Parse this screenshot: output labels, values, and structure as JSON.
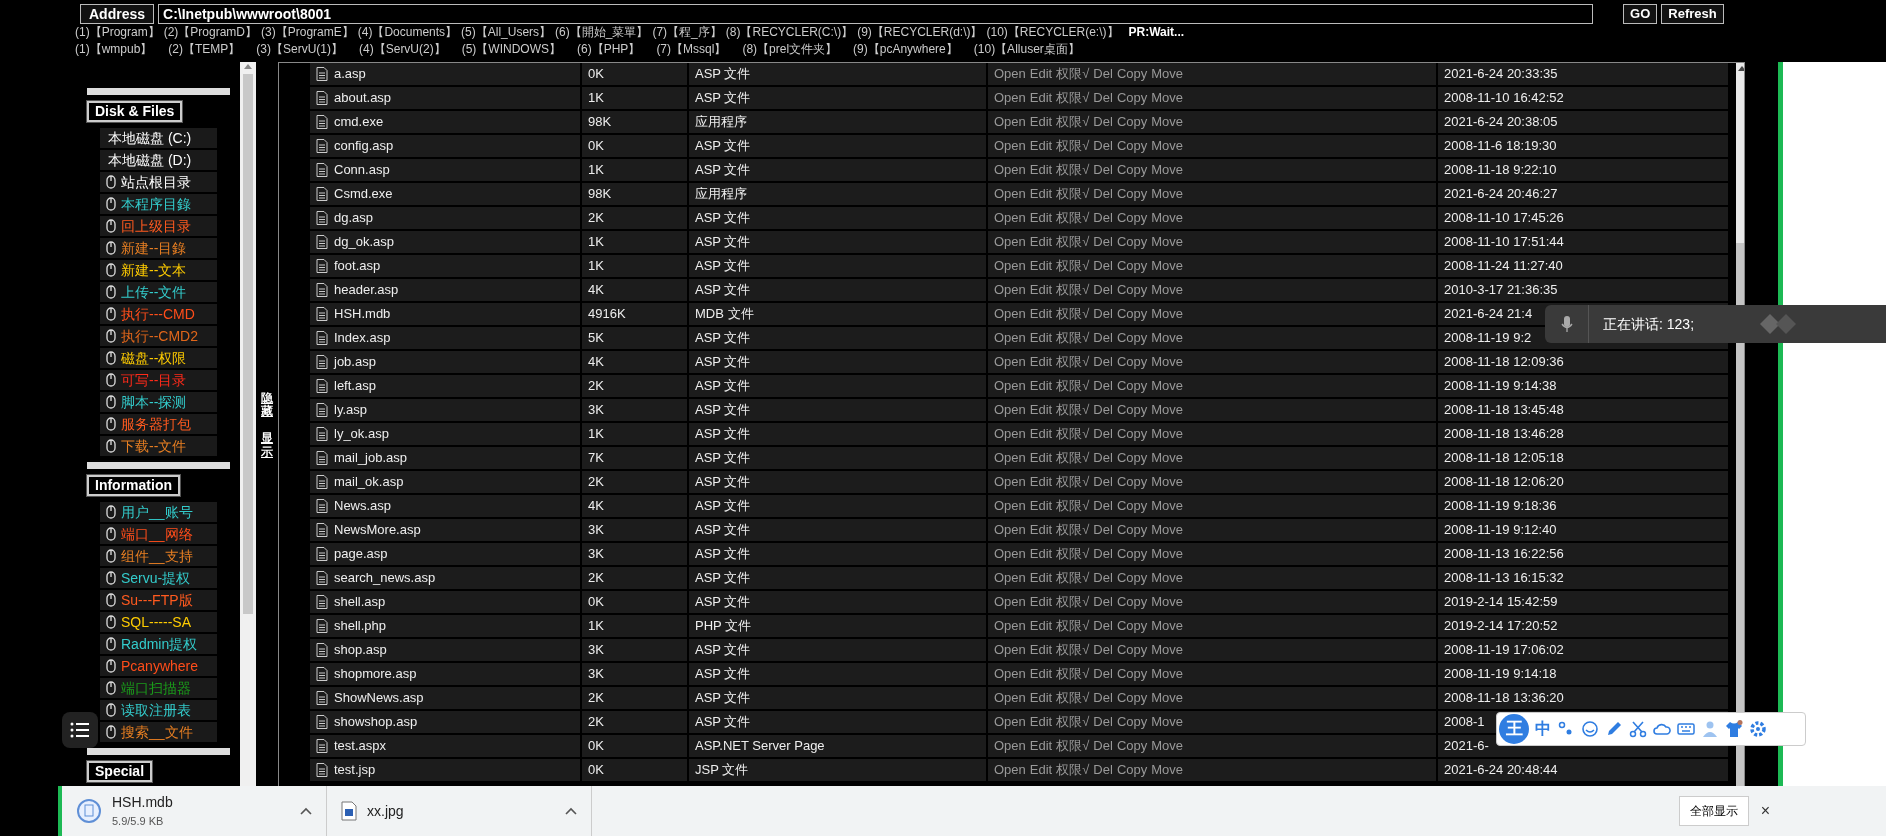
{
  "address_bar": {
    "label": "Address",
    "value": "C:\\Inetpub\\wwwroot\\8001",
    "buttons": [
      "GO",
      "Refresh"
    ]
  },
  "quick_links": [
    [
      "(1)【Program】",
      "(2)【ProgramD】",
      "(3)【ProgramE】",
      "(4)【Documents】",
      "(5)【All_Users】",
      "(6)【開始_菜單】",
      "(7)【程_序】",
      "(8)【RECYCLER(C:\\)】",
      "(9)【RECYCLER(d:\\)】",
      "(10)【RECYCLER(e:\\)】"
    ],
    [
      "(1)【wmpub】",
      "(2)【TEMP】",
      "(3)【ServU(1)】",
      "(4)【ServU(2)】",
      "(5)【WINDOWS】",
      "(6)【PHP】",
      "(7)【Mssql】",
      "(8)【prel文件夹】",
      "(9)【pcAnywhere】",
      "(10)【Alluser桌面】"
    ]
  ],
  "status": "PR:Wait...",
  "sidebar": {
    "sections": [
      {
        "title": "Disk & Files",
        "items": [
          {
            "kind": "drive",
            "label": "本地磁盘 (C:)",
            "color": "#ffffff"
          },
          {
            "kind": "drive",
            "label": "本地磁盘 (D:)",
            "color": "#ffffff"
          },
          {
            "kind": "link",
            "label": "站点根目录",
            "color": "#ffffff"
          },
          {
            "kind": "link",
            "label": "本程序目錄",
            "color": "#33cccc"
          },
          {
            "kind": "link",
            "label": "回上级目录",
            "color": "#ff5a1f"
          },
          {
            "kind": "link",
            "label": "新建--目錄",
            "color": "#e67e22"
          },
          {
            "kind": "link",
            "label": "新建--文本",
            "color": "#ffcc00"
          },
          {
            "kind": "link",
            "label": "上传--文件",
            "color": "#33cccc"
          },
          {
            "kind": "link",
            "label": "执行---CMD",
            "color": "#ff4d1a"
          },
          {
            "kind": "link",
            "label": "执行--CMD2",
            "color": "#e0661a"
          },
          {
            "kind": "link",
            "label": "磁盘--权限",
            "color": "#ffcc00"
          },
          {
            "kind": "link",
            "label": "可写--目录",
            "color": "#ff2a1a"
          },
          {
            "kind": "link",
            "label": "脚本--探测",
            "color": "#33cccc"
          },
          {
            "kind": "link",
            "label": "服务器打包",
            "color": "#ff5a1f"
          },
          {
            "kind": "link",
            "label": "下载--文件",
            "color": "#e67e22"
          }
        ]
      },
      {
        "title": "Information",
        "items": [
          {
            "kind": "link",
            "label": "用户__账号",
            "color": "#33cccc"
          },
          {
            "kind": "link",
            "label": "端口__网络",
            "color": "#ff4d1a"
          },
          {
            "kind": "link",
            "label": "组件__支持",
            "color": "#e67e22"
          },
          {
            "kind": "link",
            "label": "Servu-提权",
            "color": "#33cccc"
          },
          {
            "kind": "link",
            "label": "Su---FTP版",
            "color": "#ff5a1f"
          },
          {
            "kind": "link",
            "label": "SQL-----SA",
            "color": "#ffcc00"
          },
          {
            "kind": "link",
            "label": "Radmin提权",
            "color": "#33cccc"
          },
          {
            "kind": "link",
            "label": "Pcanywhere",
            "color": "#ff4d1a"
          },
          {
            "kind": "link",
            "label": "端口扫描器",
            "color": "#1a9a1a"
          },
          {
            "kind": "link",
            "label": "读取注册表",
            "color": "#33cccc"
          },
          {
            "kind": "link",
            "label": "搜索__文件",
            "color": "#e67e22"
          }
        ]
      },
      {
        "title": "Special"
      }
    ]
  },
  "toggle": [
    "隐藏",
    "显示"
  ],
  "files": [
    {
      "name": "a.asp",
      "size": "0K",
      "type": "ASP 文件",
      "actions": [
        "Open",
        "Edit",
        "权限√",
        "Del",
        "Copy",
        "Move"
      ],
      "modified": "2021-6-24 20:33:35"
    },
    {
      "name": "about.asp",
      "size": "1K",
      "type": "ASP 文件",
      "actions": [
        "Open",
        "Edit",
        "权限√",
        "Del",
        "Copy",
        "Move"
      ],
      "modified": "2008-11-10 16:42:52"
    },
    {
      "name": "cmd.exe",
      "size": "98K",
      "type": "应用程序",
      "actions": [
        "Open",
        "Edit",
        "权限√",
        "Del",
        "Copy",
        "Move"
      ],
      "modified": "2021-6-24 20:38:05"
    },
    {
      "name": "config.asp",
      "size": "0K",
      "type": "ASP 文件",
      "actions": [
        "Open",
        "Edit",
        "权限√",
        "Del",
        "Copy",
        "Move"
      ],
      "modified": "2008-11-6 18:19:30"
    },
    {
      "name": "Conn.asp",
      "size": "1K",
      "type": "ASP 文件",
      "actions": [
        "Open",
        "Edit",
        "权限√",
        "Del",
        "Copy",
        "Move"
      ],
      "modified": "2008-11-18 9:22:10"
    },
    {
      "name": "Csmd.exe",
      "size": "98K",
      "type": "应用程序",
      "actions": [
        "Open",
        "Edit",
        "权限√",
        "Del",
        "Copy",
        "Move"
      ],
      "modified": "2021-6-24 20:46:27"
    },
    {
      "name": "dg.asp",
      "size": "2K",
      "type": "ASP 文件",
      "actions": [
        "Open",
        "Edit",
        "权限√",
        "Del",
        "Copy",
        "Move"
      ],
      "modified": "2008-11-10 17:45:26"
    },
    {
      "name": "dg_ok.asp",
      "size": "1K",
      "type": "ASP 文件",
      "actions": [
        "Open",
        "Edit",
        "权限√",
        "Del",
        "Copy",
        "Move"
      ],
      "modified": "2008-11-10 17:51:44"
    },
    {
      "name": "foot.asp",
      "size": "1K",
      "type": "ASP 文件",
      "actions": [
        "Open",
        "Edit",
        "权限√",
        "Del",
        "Copy",
        "Move"
      ],
      "modified": "2008-11-24 11:27:40"
    },
    {
      "name": "header.asp",
      "size": "4K",
      "type": "ASP 文件",
      "actions": [
        "Open",
        "Edit",
        "权限√",
        "Del",
        "Copy",
        "Move"
      ],
      "modified": "2010-3-17 21:36:35"
    },
    {
      "name": "HSH.mdb",
      "size": "4916K",
      "type": "MDB 文件",
      "actions": [
        "Open",
        "Edit",
        "权限√",
        "Del",
        "Copy",
        "Move"
      ],
      "modified": "2021-6-24 21:4"
    },
    {
      "name": "Index.asp",
      "size": "5K",
      "type": "ASP 文件",
      "actions": [
        "Open",
        "Edit",
        "权限√",
        "Del",
        "Copy",
        "Move"
      ],
      "modified": "2008-11-19 9:2"
    },
    {
      "name": "job.asp",
      "size": "4K",
      "type": "ASP 文件",
      "actions": [
        "Open",
        "Edit",
        "权限√",
        "Del",
        "Copy",
        "Move"
      ],
      "modified": "2008-11-18 12:09:36"
    },
    {
      "name": "left.asp",
      "size": "2K",
      "type": "ASP 文件",
      "actions": [
        "Open",
        "Edit",
        "权限√",
        "Del",
        "Copy",
        "Move"
      ],
      "modified": "2008-11-19 9:14:38"
    },
    {
      "name": "ly.asp",
      "size": "3K",
      "type": "ASP 文件",
      "actions": [
        "Open",
        "Edit",
        "权限√",
        "Del",
        "Copy",
        "Move"
      ],
      "modified": "2008-11-18 13:45:48"
    },
    {
      "name": "ly_ok.asp",
      "size": "1K",
      "type": "ASP 文件",
      "actions": [
        "Open",
        "Edit",
        "权限√",
        "Del",
        "Copy",
        "Move"
      ],
      "modified": "2008-11-18 13:46:28"
    },
    {
      "name": "mail_job.asp",
      "size": "7K",
      "type": "ASP 文件",
      "actions": [
        "Open",
        "Edit",
        "权限√",
        "Del",
        "Copy",
        "Move"
      ],
      "modified": "2008-11-18 12:05:18"
    },
    {
      "name": "mail_ok.asp",
      "size": "2K",
      "type": "ASP 文件",
      "actions": [
        "Open",
        "Edit",
        "权限√",
        "Del",
        "Copy",
        "Move"
      ],
      "modified": "2008-11-18 12:06:20"
    },
    {
      "name": "News.asp",
      "size": "4K",
      "type": "ASP 文件",
      "actions": [
        "Open",
        "Edit",
        "权限√",
        "Del",
        "Copy",
        "Move"
      ],
      "modified": "2008-11-19 9:18:36"
    },
    {
      "name": "NewsMore.asp",
      "size": "3K",
      "type": "ASP 文件",
      "actions": [
        "Open",
        "Edit",
        "权限√",
        "Del",
        "Copy",
        "Move"
      ],
      "modified": "2008-11-19 9:12:40"
    },
    {
      "name": "page.asp",
      "size": "3K",
      "type": "ASP 文件",
      "actions": [
        "Open",
        "Edit",
        "权限√",
        "Del",
        "Copy",
        "Move"
      ],
      "modified": "2008-11-13 16:22:56"
    },
    {
      "name": "search_news.asp",
      "size": "2K",
      "type": "ASP 文件",
      "actions": [
        "Open",
        "Edit",
        "权限√",
        "Del",
        "Copy",
        "Move"
      ],
      "modified": "2008-11-13 16:15:32"
    },
    {
      "name": "shell.asp",
      "size": "0K",
      "type": "ASP 文件",
      "actions": [
        "Open",
        "Edit",
        "权限√",
        "Del",
        "Copy",
        "Move"
      ],
      "modified": "2019-2-14 15:42:59"
    },
    {
      "name": "shell.php",
      "size": "1K",
      "type": "PHP 文件",
      "actions": [
        "Open",
        "Edit",
        "权限√",
        "Del",
        "Copy",
        "Move"
      ],
      "modified": "2019-2-14 17:20:52"
    },
    {
      "name": "shop.asp",
      "size": "3K",
      "type": "ASP 文件",
      "actions": [
        "Open",
        "Edit",
        "权限√",
        "Del",
        "Copy",
        "Move"
      ],
      "modified": "2008-11-19 17:06:02"
    },
    {
      "name": "shopmore.asp",
      "size": "3K",
      "type": "ASP 文件",
      "actions": [
        "Open",
        "Edit",
        "权限√",
        "Del",
        "Copy",
        "Move"
      ],
      "modified": "2008-11-19 9:14:18"
    },
    {
      "name": "ShowNews.asp",
      "size": "2K",
      "type": "ASP 文件",
      "actions": [
        "Open",
        "Edit",
        "权限√",
        "Del",
        "Copy",
        "Move"
      ],
      "modified": "2008-11-18 13:36:20"
    },
    {
      "name": "showshop.asp",
      "size": "2K",
      "type": "ASP 文件",
      "actions": [
        "Open",
        "Edit",
        "权限√",
        "Del",
        "Copy",
        "Move"
      ],
      "modified": "2008-1"
    },
    {
      "name": "test.aspx",
      "size": "0K",
      "type": "ASP.NET Server Page",
      "actions": [
        "Open",
        "Edit",
        "权限√",
        "Del",
        "Copy",
        "Move"
      ],
      "modified": "2021-6-"
    },
    {
      "name": "test.jsp",
      "size": "0K",
      "type": "JSP 文件",
      "actions": [
        "Open",
        "Edit",
        "权限√",
        "Del",
        "Copy",
        "Move"
      ],
      "modified": "2021-6-24 20:48:44"
    }
  ],
  "voice_popup": {
    "text": "正在讲话: 123;"
  },
  "ime_toolbar": {
    "logo": "王",
    "mode": "中"
  },
  "downloads": {
    "items": [
      {
        "name": "HSH.mdb",
        "status": "5.9/5.9 KB",
        "kind": "file"
      },
      {
        "name": "xx.jpg",
        "kind": "image"
      }
    ],
    "show_all": "全部显示",
    "close": "×"
  }
}
